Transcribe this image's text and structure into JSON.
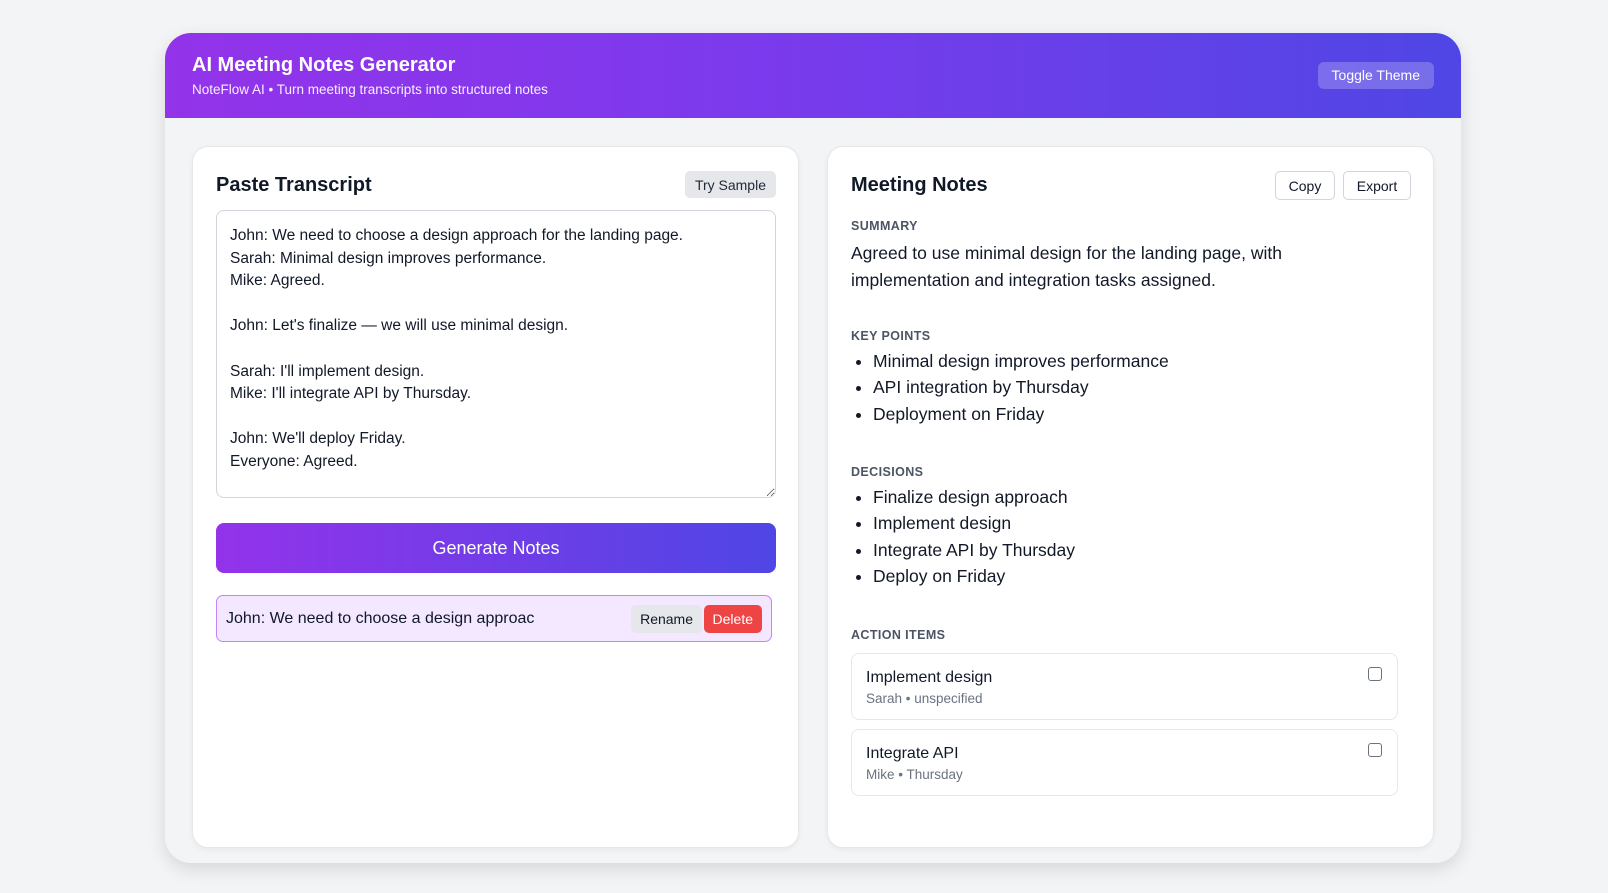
{
  "header": {
    "title": "AI Meeting Notes Generator",
    "subtitle": "NoteFlow AI • Turn meeting transcripts into structured notes",
    "toggle_label": "Toggle Theme"
  },
  "transcript_panel": {
    "title": "Paste Transcript",
    "try_sample_label": "Try Sample",
    "transcript_value": "John: We need to choose a design approach for the landing page.\nSarah: Minimal design improves performance.\nMike: Agreed.\n\nJohn: Let's finalize — we will use minimal design.\n\nSarah: I'll implement design.\nMike: I'll integrate API by Thursday.\n\nJohn: We'll deploy Friday.\nEveryone: Agreed.",
    "generate_label": "Generate Notes",
    "saved_items": [
      {
        "label": "John: We need to choose a design approac",
        "rename_label": "Rename",
        "delete_label": "Delete"
      }
    ]
  },
  "notes_panel": {
    "title": "Meeting Notes",
    "copy_label": "Copy",
    "export_label": "Export",
    "summary_label": "SUMMARY",
    "summary_text": "Agreed to use minimal design for the landing page, with implementation and integration tasks assigned.",
    "key_points_label": "KEY POINTS",
    "key_points": [
      "Minimal design improves performance",
      "API integration by Thursday",
      "Deployment on Friday"
    ],
    "decisions_label": "DECISIONS",
    "decisions": [
      "Finalize design approach",
      "Implement design",
      "Integrate API by Thursday",
      "Deploy on Friday"
    ],
    "action_items_label": "ACTION ITEMS",
    "action_items": [
      {
        "title": "Implement design",
        "meta": "Sarah • unspecified",
        "checked": false
      },
      {
        "title": "Integrate API",
        "meta": "Mike • Thursday",
        "checked": false
      }
    ]
  },
  "colors": {
    "header_gradient_start": "#9333ea",
    "header_gradient_end": "#4f46e5",
    "delete": "#ef4444",
    "saved_item_bg": "#f3e8ff"
  }
}
